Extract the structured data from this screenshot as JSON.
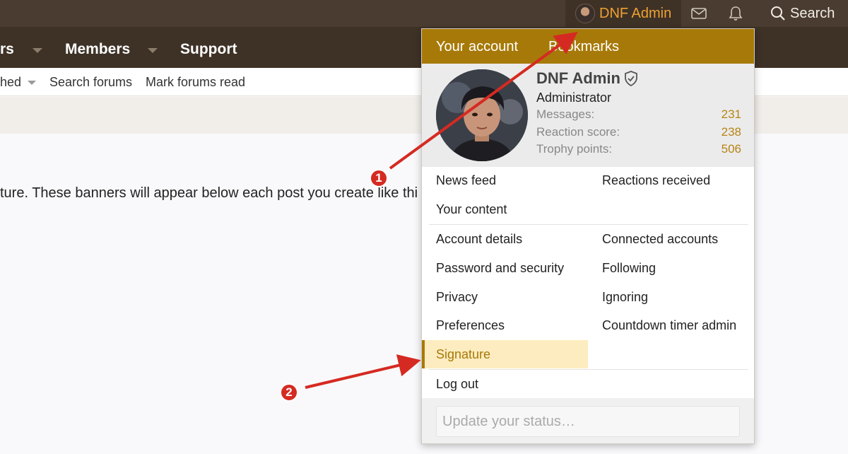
{
  "topbar": {
    "account_name": "DNF Admin",
    "icons": [
      "envelope-icon",
      "bell-icon",
      "search-icon"
    ],
    "search_label": "Search"
  },
  "navbar": {
    "items": [
      {
        "label": "rs"
      },
      {
        "label": "Members"
      },
      {
        "label": "Support"
      }
    ]
  },
  "subnav": {
    "items": [
      {
        "label": "hed"
      },
      {
        "label": "Search forums"
      },
      {
        "label": "Mark forums read"
      }
    ]
  },
  "content": {
    "text": "ture. These banners will appear below each post you create like thi"
  },
  "menu": {
    "tabs": [
      "Your account",
      "Bookmarks"
    ],
    "profile": {
      "name": "DNF Admin",
      "role": "Administrator",
      "stats": [
        {
          "label": "Messages:",
          "value": "231"
        },
        {
          "label": "Reaction score:",
          "value": "238"
        },
        {
          "label": "Trophy points:",
          "value": "506"
        }
      ]
    },
    "group1": {
      "left": [
        "News feed",
        "Your content"
      ],
      "right": [
        "Reactions received"
      ]
    },
    "group2": {
      "left": [
        "Account details",
        "Password and security",
        "Privacy",
        "Preferences",
        "Signature"
      ],
      "right": [
        "Connected accounts",
        "Following",
        "Ignoring",
        "Countdown timer admin"
      ]
    },
    "logout": "Log out",
    "status_placeholder": "Update your status…"
  },
  "annotations": [
    "1",
    "2"
  ],
  "colors": {
    "topbar": "#4a3c30",
    "navbar": "#3e3227",
    "accent": "#a77908",
    "account_name": "#f0a030",
    "highlight": "#fdecbf",
    "arrow": "#d52a22"
  }
}
